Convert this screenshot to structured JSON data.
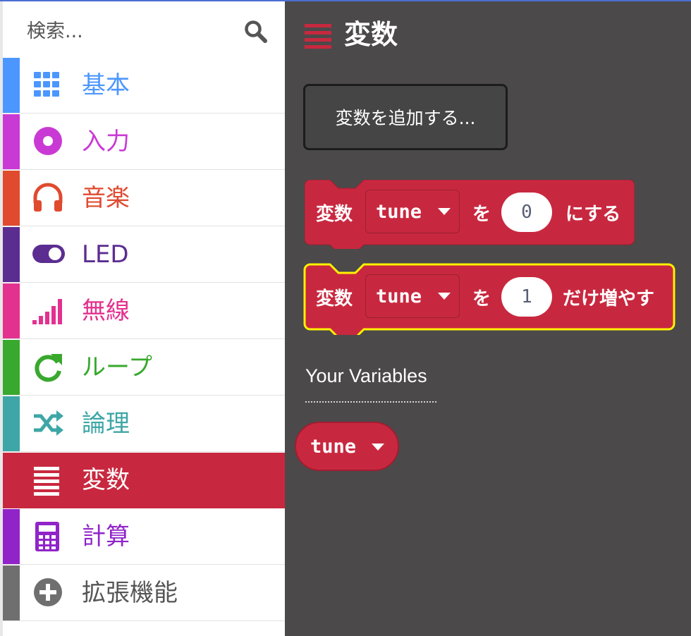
{
  "search": {
    "placeholder": "検索..."
  },
  "toolbox": {
    "categories": [
      {
        "label": "基本",
        "icon": "grid-icon",
        "color": "#4c97ff"
      },
      {
        "label": "入力",
        "icon": "record-icon",
        "color": "#c93ad4"
      },
      {
        "label": "音楽",
        "icon": "headphones-icon",
        "color": "#e04a2f"
      },
      {
        "label": "LED",
        "icon": "toggle-icon",
        "color": "#5c2d91"
      },
      {
        "label": "無線",
        "icon": "signal-bars-icon",
        "color": "#e3318f"
      },
      {
        "label": "ループ",
        "icon": "refresh-icon",
        "color": "#39a82e"
      },
      {
        "label": "論理",
        "icon": "shuffle-icon",
        "color": "#3ea6a6"
      },
      {
        "label": "変数",
        "icon": "list-lines-icon",
        "color": "#c8283f"
      },
      {
        "label": "計算",
        "icon": "calculator-icon",
        "color": "#9124c9"
      },
      {
        "label": "拡張機能",
        "icon": "plus-circle-icon",
        "color": "#6f6f6f"
      }
    ],
    "selected_index": 7
  },
  "flyout": {
    "title": "変数",
    "add_variable_button": "変数を追加する...",
    "blocks": [
      {
        "prefix": "変数",
        "variable": "tune",
        "middle": "を",
        "value": "0",
        "suffix": "にする",
        "highlighted": false
      },
      {
        "prefix": "変数",
        "variable": "tune",
        "middle": "を",
        "value": "1",
        "suffix": "だけ増やす",
        "highlighted": true
      }
    ],
    "your_variables_heading": "Your Variables",
    "variables": [
      "tune"
    ]
  },
  "colors": {
    "variables_block": "#c8283f",
    "flyout_bg": "#4b494a",
    "highlight_outline": "#fff200"
  }
}
